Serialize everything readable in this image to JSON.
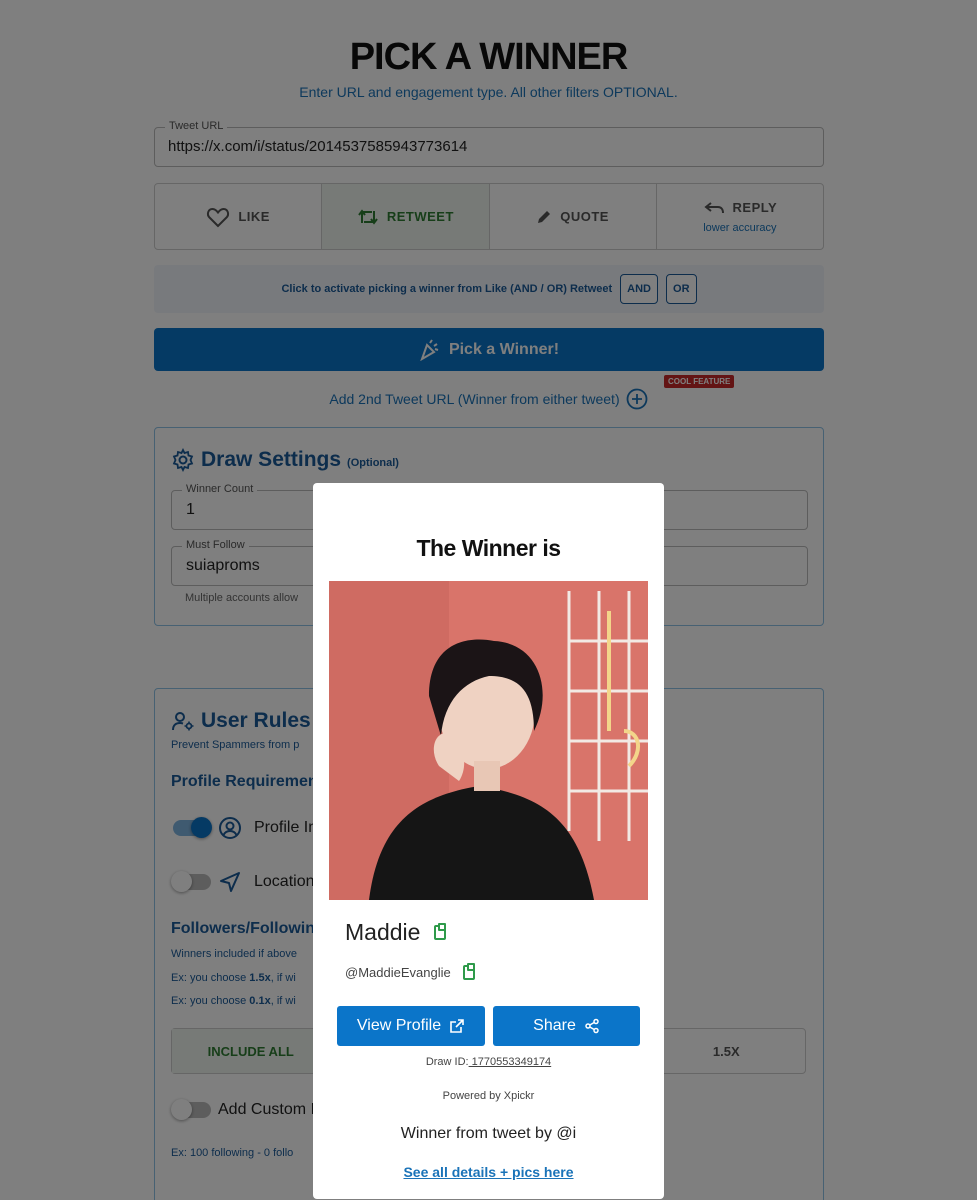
{
  "header": {
    "title": "PICK A WINNER",
    "subtitle": "Enter URL and engagement type. All other filters OPTIONAL."
  },
  "tweet_url": {
    "label": "Tweet URL",
    "value": "https://x.com/i/status/2014537585943773614"
  },
  "engagement": {
    "options": [
      {
        "label": "LIKE",
        "icon": "heart-icon",
        "active": false
      },
      {
        "label": "RETWEET",
        "icon": "retweet-icon",
        "active": true
      },
      {
        "label": "QUOTE",
        "icon": "pencil-icon",
        "active": false
      },
      {
        "label": "REPLY",
        "icon": "reply-icon",
        "sub": "lower accuracy",
        "active": false
      }
    ]
  },
  "and_or": {
    "text": "Click to activate picking a winner from Like (AND / OR) Retweet",
    "and_label": "AND",
    "or_label": "OR"
  },
  "pick_button": {
    "label": "Pick a Winner!"
  },
  "add_second": {
    "label": "Add 2nd Tweet URL (Winner from either tweet)",
    "badge": "COOL FEATURE"
  },
  "draw_settings": {
    "title": "Draw Settings",
    "optional": "(Optional)",
    "winner_count": {
      "label": "Winner Count",
      "value": "1"
    },
    "must_follow": {
      "label": "Must Follow",
      "value": "suiaproms"
    },
    "hint": "Multiple accounts allow"
  },
  "user_rules": {
    "title": "User Rules",
    "title_suffix": "(",
    "subtitle": "Prevent Spammers from p",
    "profile_heading": "Profile Requirement",
    "profile_image": {
      "label": "Profile Im",
      "on": true
    },
    "location": {
      "label": "Location",
      "on": false
    },
    "followers_heading": "Followers/Followin",
    "followers_note": "Winners included if above",
    "ex1_pre": "Ex: you choose ",
    "ex1_val": "1.5x",
    "ex1_post": ", if wi",
    "ex2_pre": "Ex: you choose ",
    "ex2_val": "0.1x",
    "ex2_post": ", if wi",
    "ratio_options": [
      "INCLUDE ALL",
      "",
      "",
      "1.5X"
    ],
    "custom": {
      "label": "Add Custom I",
      "on": false
    },
    "custom_example": "Ex: 100 following - 0 follo"
  },
  "modal": {
    "title": "The Winner is",
    "name": "Maddie",
    "handle": "@MaddieEvanglie",
    "view_profile": "View Profile",
    "share": "Share",
    "draw_id_label": "Draw ID:",
    "draw_id": " 1770553349174",
    "powered": "Powered by Xpickr",
    "from_tweet": "Winner from tweet by @i",
    "see_all": "See all details + pics here"
  },
  "colors": {
    "brand_blue": "#0b75c9",
    "heading_blue": "#1a5a99",
    "active_green": "#2e7d32",
    "badge_red": "#c62828"
  }
}
